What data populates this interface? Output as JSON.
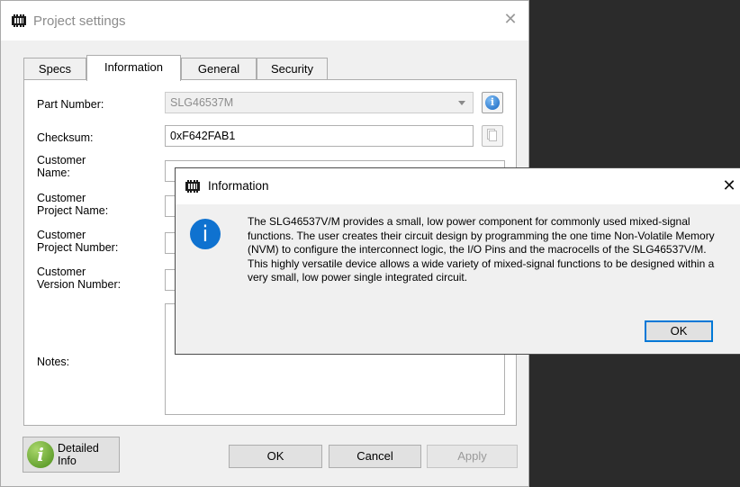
{
  "window": {
    "title": "Project settings",
    "close_glyph": "✕"
  },
  "tabs": [
    {
      "label": "Specs",
      "active": false
    },
    {
      "label": "Information",
      "active": true
    },
    {
      "label": "General",
      "active": false
    },
    {
      "label": "Security",
      "active": false
    }
  ],
  "form": {
    "part_number": {
      "label": "Part Number:",
      "value": "SLG46537M"
    },
    "checksum": {
      "label": "Checksum:",
      "value": "0xF642FAB1"
    },
    "customer_name": {
      "label_line1": "Customer",
      "label_line2": "Name:",
      "value": ""
    },
    "customer_project_name": {
      "label_line1": "Customer",
      "label_line2": "Project Name:",
      "value": ""
    },
    "customer_project_number": {
      "label_line1": "Customer",
      "label_line2": "Project Number:",
      "value": ""
    },
    "customer_version_number": {
      "label_line1": "Customer",
      "label_line2": "Version Number:",
      "value": ""
    },
    "notes": {
      "label": "Notes:",
      "value": ""
    }
  },
  "icons": {
    "app_icon": "chip-icon",
    "part_info": "info-icon",
    "copy": "copy-icon",
    "detailed_info": "green-info-icon",
    "dialog": "information-icon"
  },
  "buttons": {
    "detailed_info_line1": "Detailed",
    "detailed_info_line2": "Info",
    "ok": "OK",
    "cancel": "Cancel",
    "apply": "Apply"
  },
  "dialog": {
    "title": "Information",
    "close_glyph": "✕",
    "icon_glyph": "i",
    "message": "The SLG46537V/M provides a small, low power component for commonly used mixed-signal functions. The user creates their circuit design by programming the one time Non-Volatile Memory (NVM) to configure the interconnect logic, the I/O Pins and the macrocells of the SLG46537V/M. This highly versatile device allows a wide variety of mixed-signal functions to be designed within a very small, low power single integrated circuit.",
    "ok_label": "OK"
  },
  "colors": {
    "accent": "#0078d7",
    "info_blue": "#0f72d0",
    "detail_green": "#4a8e1a",
    "backdrop": "#2b2b2b"
  }
}
